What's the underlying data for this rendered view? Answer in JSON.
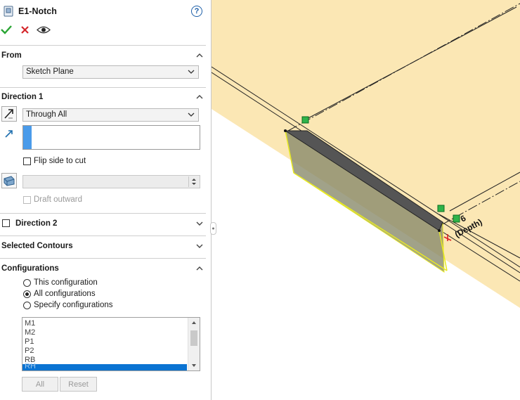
{
  "feature": {
    "title": "E1-Notch"
  },
  "actions": {
    "ok": "ok",
    "cancel": "cancel",
    "preview": "preview"
  },
  "from": {
    "header": "From",
    "selected": "Sketch Plane"
  },
  "direction1": {
    "header": "Direction 1",
    "end_condition": "Through All",
    "flip_side_label": "Flip side to cut",
    "flip_side_checked": false,
    "draft_outward_label": "Draft outward"
  },
  "direction2": {
    "header": "Direction 2",
    "checked": false
  },
  "selected_contours": {
    "header": "Selected Contours"
  },
  "configurations": {
    "header": "Configurations",
    "options": [
      "This configuration",
      "All configurations",
      "Specify configurations"
    ],
    "selected_option": "All configurations",
    "list": [
      "M1",
      "M2",
      "P1",
      "P2",
      "RB",
      "RH"
    ],
    "buttons": {
      "all": "All",
      "reset": "Reset"
    }
  },
  "viewport": {
    "dimension_value": "6",
    "dimension_label": "(Depth)",
    "colors": {
      "plane": "#fbe7b4",
      "extrude": "#8a8b6c",
      "highlight": "#e8ea22"
    }
  }
}
